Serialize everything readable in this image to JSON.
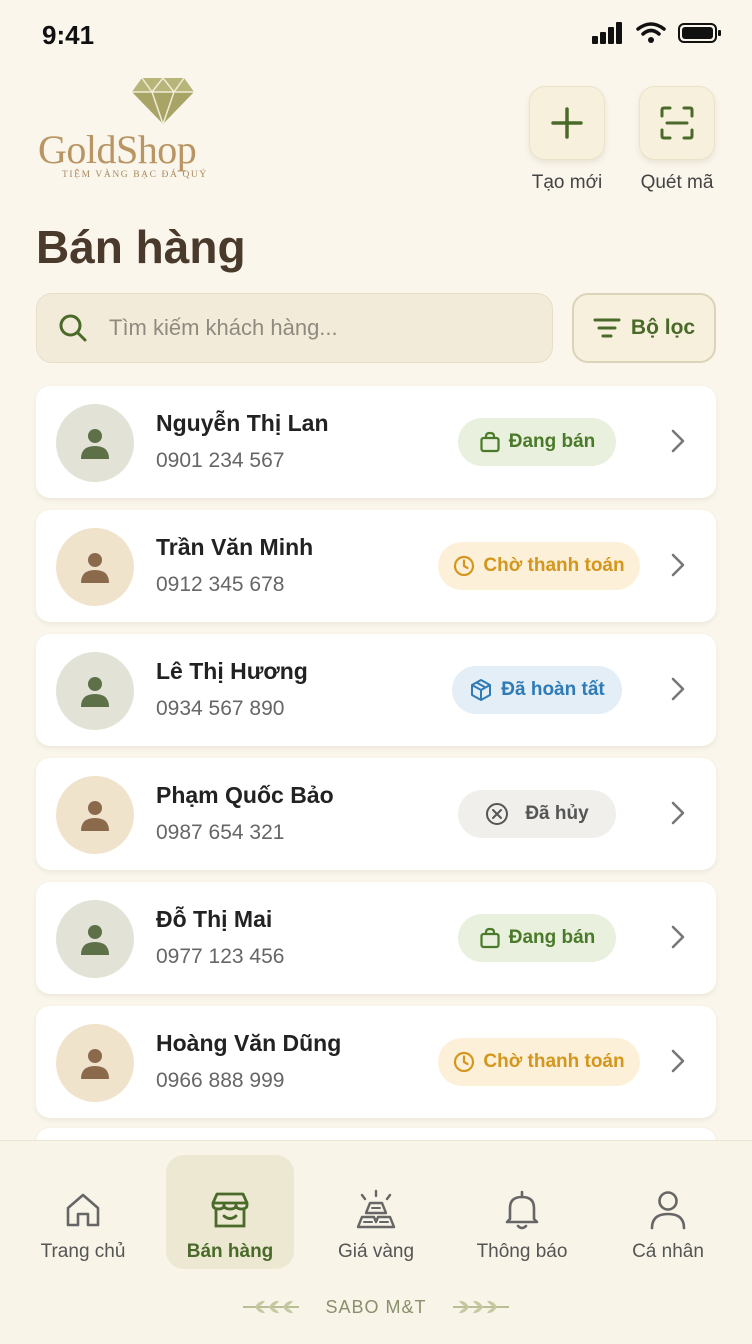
{
  "status_bar": {
    "time": "9:41"
  },
  "brand": {
    "name": "GoldShop",
    "tagline": "TIỆM VÀNG BẠC ĐÁ QUÝ"
  },
  "header": {
    "title": "Bán hàng",
    "actions": [
      {
        "label": "Tạo mới",
        "icon": "plus-icon"
      },
      {
        "label": "Quét mã",
        "icon": "scan-icon"
      }
    ]
  },
  "search": {
    "placeholder": "Tìm kiếm khách hàng...",
    "value": ""
  },
  "filter": {
    "label": "Bộ lọc"
  },
  "customers": [
    {
      "name": "Nguyễn Thị Lan",
      "phone": "0901 234 567",
      "status": "Đang bán",
      "status_type": "selling",
      "avatar": "green"
    },
    {
      "name": "Trần Văn Minh",
      "phone": "0912 345 678",
      "status": "Chờ thanh toán",
      "status_type": "pending",
      "avatar": "tan"
    },
    {
      "name": "Lê Thị Hương",
      "phone": "0934 567 890",
      "status": "Đã hoàn tất",
      "status_type": "done",
      "avatar": "green"
    },
    {
      "name": "Phạm Quốc Bảo",
      "phone": "0987 654 321",
      "status": "Đã hủy",
      "status_type": "cancel",
      "avatar": "tan"
    },
    {
      "name": "Đỗ Thị Mai",
      "phone": "0977 123 456",
      "status": "Đang bán",
      "status_type": "selling",
      "avatar": "green"
    },
    {
      "name": "Hoàng Văn Dũng",
      "phone": "0966 888 999",
      "status": "Chờ thanh toán",
      "status_type": "pending",
      "avatar": "tan"
    }
  ],
  "nav": [
    {
      "label": "Trang chủ",
      "icon": "home-icon",
      "active": false
    },
    {
      "label": "Bán hàng",
      "icon": "store-icon",
      "active": true
    },
    {
      "label": "Giá vàng",
      "icon": "gold-bar-icon",
      "active": false
    },
    {
      "label": "Thông báo",
      "icon": "bell-icon",
      "active": false
    },
    {
      "label": "Cá nhân",
      "icon": "user-icon",
      "active": false
    }
  ],
  "footer": {
    "text": "SABO M&T"
  },
  "colors": {
    "accent_green": "#4a6a2a",
    "gold": "#b89563",
    "background": "#faf6ec",
    "selling": "#4a7a2a",
    "pending": "#d4961c",
    "done": "#2e7bb8",
    "cancel": "#555555"
  }
}
